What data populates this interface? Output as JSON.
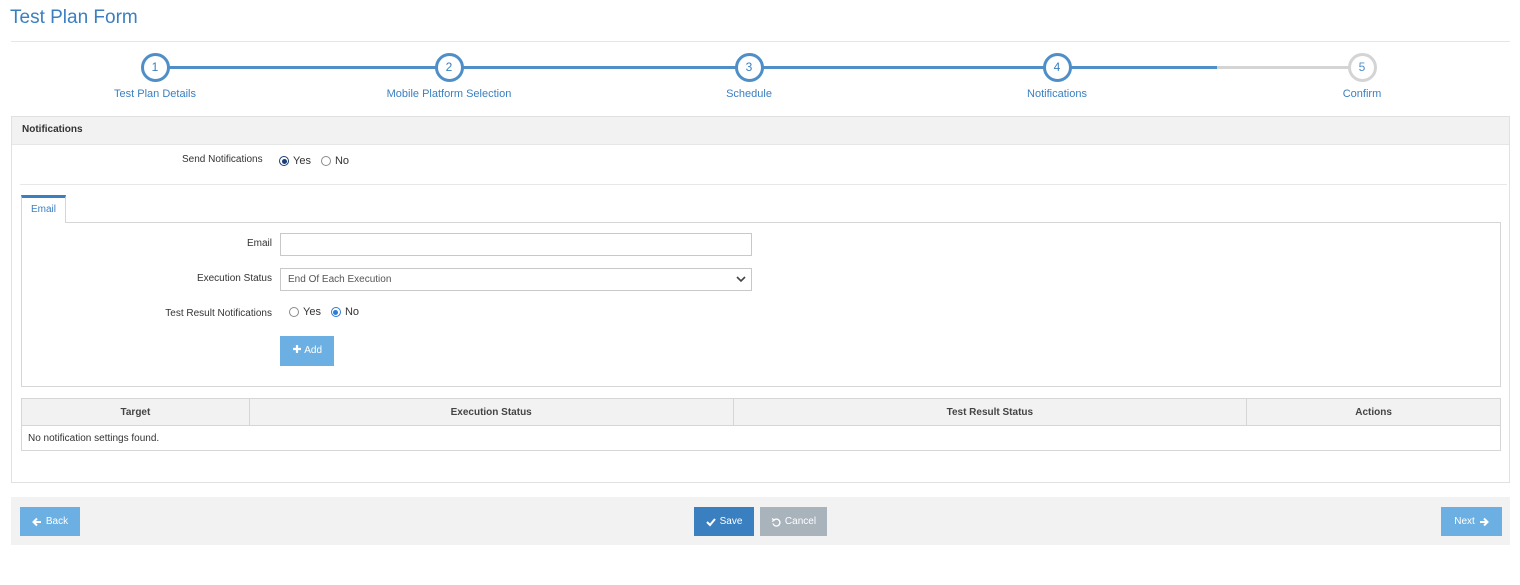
{
  "page": {
    "title": "Test Plan Form"
  },
  "wizard": {
    "steps": [
      {
        "number": "1",
        "label": "Test Plan Details"
      },
      {
        "number": "2",
        "label": "Mobile Platform Selection"
      },
      {
        "number": "3",
        "label": "Schedule"
      },
      {
        "number": "4",
        "label": "Notifications"
      },
      {
        "number": "5",
        "label": "Confirm"
      }
    ]
  },
  "panel": {
    "header": "Notifications",
    "send_label": "Send Notifications",
    "send_yes": "Yes",
    "send_no": "No",
    "tab_label": "Email",
    "email_label": "Email",
    "email_value": "",
    "exec_status_label": "Execution Status",
    "exec_status_value": "End Of Each Execution",
    "test_result_label": "Test Result Notifications",
    "test_result_yes": "Yes",
    "test_result_no": "No",
    "add_button": "Add"
  },
  "table": {
    "columns": [
      "Target",
      "Execution Status",
      "Test Result Status",
      "Actions"
    ],
    "empty_message": "No notification settings found."
  },
  "footer": {
    "back": "Back",
    "save": "Save",
    "cancel": "Cancel",
    "next": "Next"
  },
  "colors": {
    "primary": "#3a7fc0",
    "light_button": "#6cb0e3",
    "cancel_button": "#a9b3bc",
    "step_pending": "#d4d4d4"
  }
}
